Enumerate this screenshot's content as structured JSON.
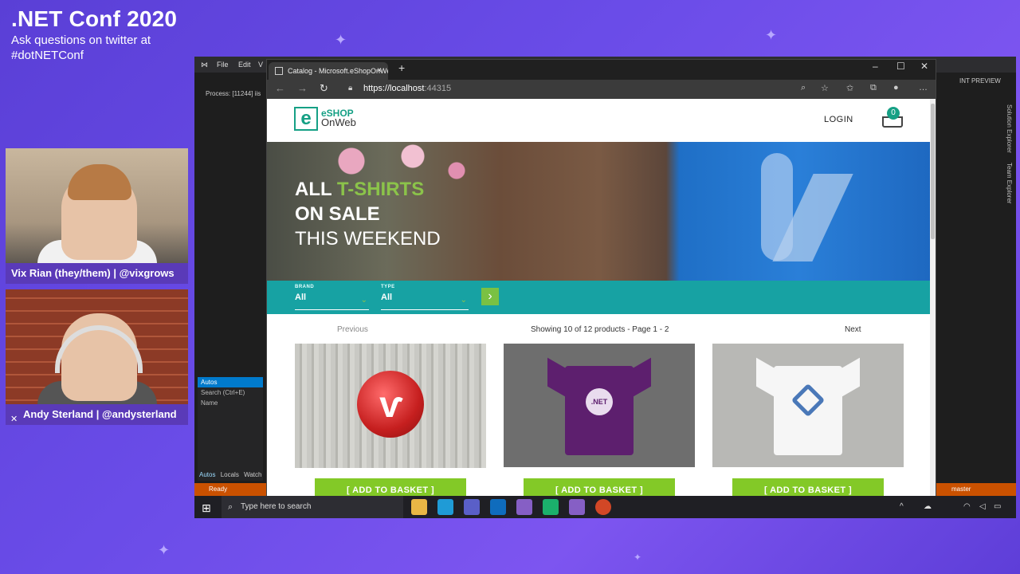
{
  "conference": {
    "title": ".NET Conf 2020",
    "subtitle": "Ask questions on twitter at #dotNETConf"
  },
  "speakers": [
    {
      "name": "Vix Rian (they/them) | @vixgrows"
    },
    {
      "name": "Andy Sterland | @andysterland"
    }
  ],
  "vs": {
    "menu": [
      "File",
      "Edit",
      "V"
    ],
    "process": "Process: [11244] iis",
    "int_preview": "INT PREVIEW",
    "autos_title": "Autos",
    "search_placeholder": "Search (Ctrl+E)",
    "name_col": "Name",
    "bottom_tabs": [
      "Autos",
      "Locals",
      "Watch"
    ],
    "status": "Ready",
    "branch": "master",
    "right_strip": [
      "Solution Explorer",
      "Team Explorer"
    ]
  },
  "browser": {
    "tab_title": "Catalog - Microsoft.eShopOnWeb",
    "url_host": "https://localhost",
    "url_port": ":44315"
  },
  "site": {
    "logo_main": "eSHOP",
    "logo_sub": "OnWeb",
    "logo_letter": "e",
    "login": "LOGIN",
    "cart_count": "0",
    "banner": {
      "line1_a": "ALL",
      "line1_b": "T-SHIRTS",
      "line2": "ON SALE",
      "line3": "THIS WEEKEND"
    },
    "filters": {
      "brand_label": "BRAND",
      "brand_value": "All",
      "type_label": "TYPE",
      "type_value": "All"
    },
    "pager": {
      "previous": "Previous",
      "info": "Showing 10 of 12 products - Page 1 - 2",
      "next": "Next"
    },
    "products": [
      {
        "button": "[ ADD TO BASKET ]"
      },
      {
        "button": "[ ADD TO BASKET ]",
        "mark": ".NET"
      },
      {
        "button": "[ ADD TO BASKET ]"
      }
    ]
  },
  "taskbar": {
    "search_placeholder": "Type here to search"
  },
  "colors": {
    "accent_teal": "#17a2a3",
    "button_green": "#83c927",
    "brand_green": "#16a085",
    "vs_status": "#ca5100"
  }
}
